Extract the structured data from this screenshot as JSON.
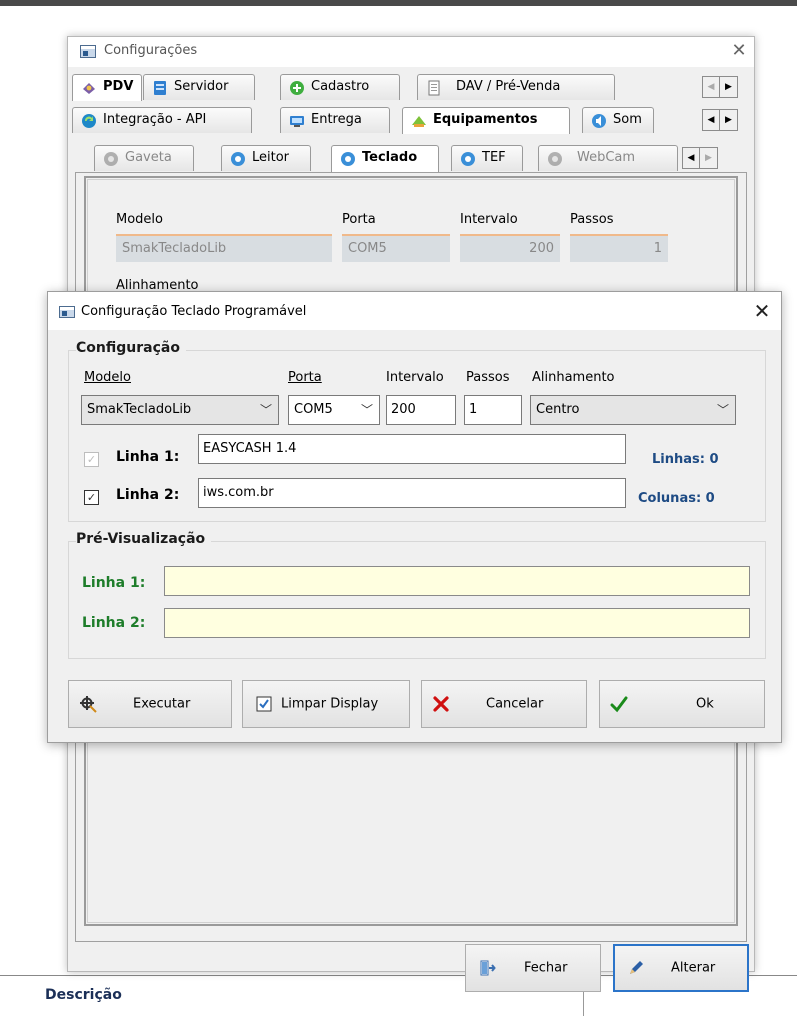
{
  "background": {
    "descricao_label": "Descrição"
  },
  "main_window": {
    "title": "Configurações",
    "tabs_row1": [
      "PDV",
      "Servidor",
      "Cadastro",
      "DAV / Pré-Venda"
    ],
    "tabs_row2": [
      "Integração - API",
      "Entrega",
      "Equipamentos",
      "Som"
    ],
    "tabs_row3": [
      "Gaveta",
      "Leitor",
      "Teclado",
      "TEF",
      "WebCam"
    ],
    "panel": {
      "modelo_label": "Modelo",
      "porta_label": "Porta",
      "intervalo_label": "Intervalo",
      "passos_label": "Passos",
      "modelo_value": "SmakTecladoLib",
      "porta_value": "COM5",
      "intervalo_value": "200",
      "passos_value": "1",
      "alinhamento_label": "Alinhamento"
    },
    "buttons": {
      "fechar": "Fechar",
      "alterar": "Alterar"
    }
  },
  "dialog": {
    "title": "Configuração Teclado Programável",
    "config_group": "Configuração",
    "labels": {
      "modelo": "Modelo",
      "porta": "Porta",
      "intervalo": "Intervalo",
      "passos": "Passos",
      "alinhamento": "Alinhamento"
    },
    "values": {
      "modelo": "SmakTecladoLib",
      "porta": "COM5",
      "intervalo": "200",
      "passos": "1",
      "alinhamento": "Centro"
    },
    "linha1_label": "Linha 1:",
    "linha1_value": "EASYCASH 1.4",
    "linha1_checked": true,
    "linha2_label": "Linha 2:",
    "linha2_value": "iws.com.br",
    "linha2_checked": true,
    "linhas_label": "Linhas: 0",
    "colunas_label": "Colunas: 0",
    "preview_group": "Pré-Visualização",
    "preview_linha1": "Linha 1:",
    "preview_linha2": "Linha 2:",
    "buttons": {
      "executar": "Executar",
      "limpar": "Limpar Display",
      "cancelar": "Cancelar",
      "ok": "Ok"
    }
  },
  "colors": {
    "navy_label": "#1e4b84",
    "preview_green": "#1e7d2a",
    "preview_bg": "#ffffe0",
    "cancel_red": "#d01010",
    "ok_green": "#1a8a1a"
  }
}
